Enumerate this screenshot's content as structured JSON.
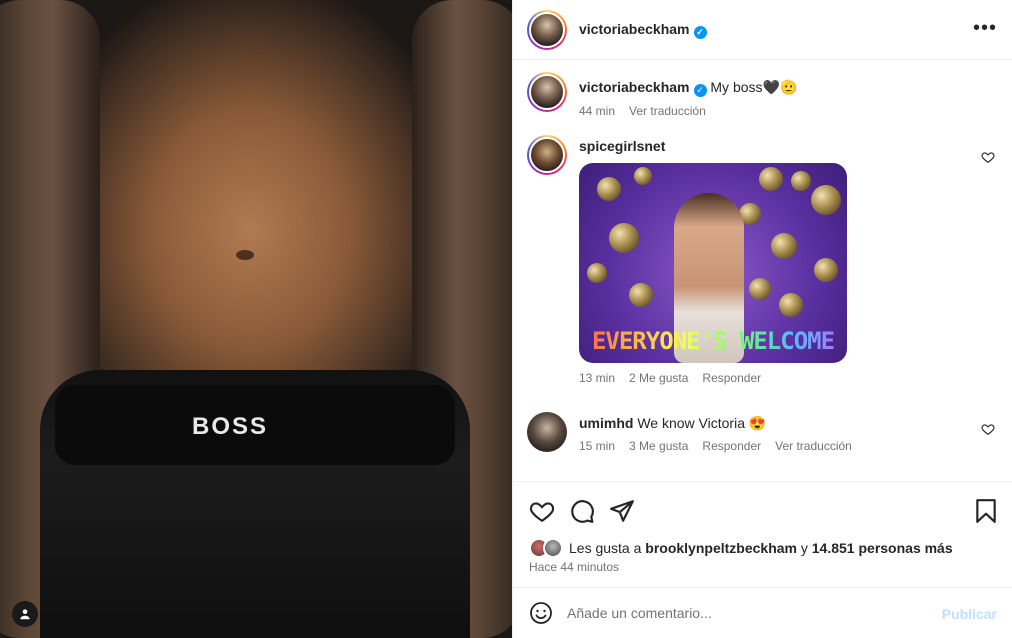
{
  "post": {
    "author": "victoriabeckham",
    "image_brand_text": "BOSS"
  },
  "header": {
    "username": "victoriabeckham",
    "more_icon": "more-horizontal-icon"
  },
  "caption": {
    "username": "victoriabeckham",
    "text": "My boss🖤🫡",
    "time": "44 min",
    "translate": "Ver traducción"
  },
  "comments": [
    {
      "username": "spicegirlsnet",
      "text": "",
      "gif_caption": "EVERYONE'S WELCOME",
      "time": "13 min",
      "likes": "2 Me gusta",
      "reply": "Responder"
    },
    {
      "username": "umimhd",
      "text": "We know Victoria 😍",
      "time": "15 min",
      "likes": "3 Me gusta",
      "reply": "Responder",
      "translate": "Ver traducción"
    }
  ],
  "actions": {
    "likes_prefix": "Les gusta a",
    "likes_user": "brooklynpeltzbeckham",
    "likes_mid": "y",
    "likes_count": "14.851 personas más",
    "time_ago": "Hace 44 minutos"
  },
  "add_comment": {
    "placeholder": "Añade un comentario...",
    "publish": "Publicar"
  },
  "colors": {
    "accent": "#0095f6",
    "publish_disabled": "#c0dffd",
    "secondary_text": "#737373"
  }
}
